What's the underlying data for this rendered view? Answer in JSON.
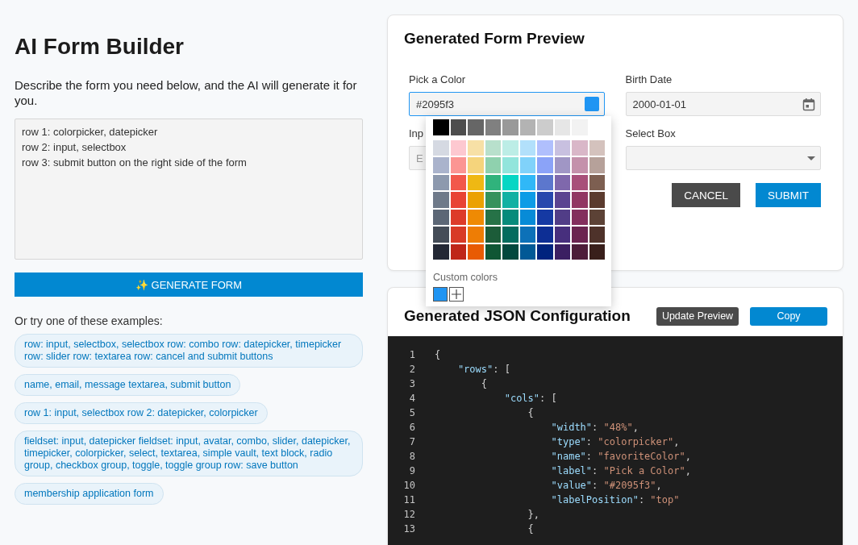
{
  "builder": {
    "title": "AI Form Builder",
    "description": "Describe the form you need below, and the AI will generate it for you.",
    "prompt": "row 1: colorpicker, datepicker\nrow 2: input, selectbox\nrow 3: submit button on the right side of the form",
    "generate_button": "✨ GENERATE FORM",
    "examples_heading": "Or try one of these examples:",
    "examples": [
      "row: input, selectbox, selectbox row: combo row: datepicker, timepicker row: slider row: textarea row: cancel and submit buttons",
      "name, email, message textarea, submit button",
      "row 1: input, selectbox row 2: datepicker, colorpicker",
      "fieldset: input, datepicker fieldset: input, avatar, combo, slider, datepicker, timepicker, colorpicker, select, textarea, simple vault, text block, radio group, checkbox group, toggle, toggle group row: save button",
      "membership application form"
    ]
  },
  "preview": {
    "title": "Generated Form Preview",
    "fields": [
      {
        "kind": "color",
        "label": "Pick a Color",
        "value": "#2095f3",
        "color": "#2095f3"
      },
      {
        "kind": "date",
        "label": "Birth Date",
        "value": "2000-01-01"
      },
      {
        "kind": "input",
        "label": "Inp",
        "placeholder": "E"
      },
      {
        "kind": "select",
        "label": "Select Box"
      }
    ],
    "buttons": [
      {
        "kind": "cancel",
        "label": "CANCEL"
      },
      {
        "kind": "submit",
        "label": "SUBMIT"
      }
    ],
    "color_picker": {
      "grays": [
        {
          "color": "#000000"
        },
        {
          "color": "#4d4d4d"
        },
        {
          "color": "#666666"
        },
        {
          "color": "#808080"
        },
        {
          "color": "#999999"
        },
        {
          "color": "#b3b3b3"
        },
        {
          "color": "#cccccc"
        },
        {
          "color": "#e6e6e6"
        },
        {
          "color": "#f2f2f2"
        }
      ],
      "palette": [
        {
          "swatches": [
            {
              "color": "#d5d9e2"
            },
            {
              "color": "#fdc8d0"
            },
            {
              "color": "#f7e0a6"
            },
            {
              "color": "#b8e0cc"
            },
            {
              "color": "#bcede6"
            },
            {
              "color": "#b2e0fb"
            },
            {
              "color": "#b0bffd"
            },
            {
              "color": "#c8c0e0"
            },
            {
              "color": "#d9b7c8"
            },
            {
              "color": "#d4c2bd"
            }
          ]
        },
        {
          "swatches": [
            {
              "color": "#aab3cc"
            },
            {
              "color": "#fb9593"
            },
            {
              "color": "#f5d47c"
            },
            {
              "color": "#8fd1ae"
            },
            {
              "color": "#92e5dc"
            },
            {
              "color": "#80d2fa"
            },
            {
              "color": "#8ba3f8"
            },
            {
              "color": "#a096c5"
            },
            {
              "color": "#c491ab"
            },
            {
              "color": "#b6a19a"
            }
          ]
        },
        {
          "swatches": [
            {
              "color": "#8d99ae"
            },
            {
              "color": "#f2584b"
            },
            {
              "color": "#efb813"
            },
            {
              "color": "#30b37c"
            },
            {
              "color": "#06d6c4"
            },
            {
              "color": "#30b8f7"
            },
            {
              "color": "#5c77cd"
            },
            {
              "color": "#7f68ac"
            },
            {
              "color": "#a8507a"
            },
            {
              "color": "#7d5f51"
            }
          ]
        },
        {
          "swatches": [
            {
              "color": "#6f7a8a"
            },
            {
              "color": "#e84435"
            },
            {
              "color": "#eba102"
            },
            {
              "color": "#36925d"
            },
            {
              "color": "#12b1a3"
            },
            {
              "color": "#0d9ce6"
            },
            {
              "color": "#2748ad"
            },
            {
              "color": "#5b4491"
            },
            {
              "color": "#913763"
            },
            {
              "color": "#5b3b2e"
            }
          ]
        },
        {
          "swatches": [
            {
              "color": "#5c6776"
            },
            {
              "color": "#dd3b2a"
            },
            {
              "color": "#ef8a03"
            },
            {
              "color": "#267247"
            },
            {
              "color": "#068b7b"
            },
            {
              "color": "#078bd7"
            },
            {
              "color": "#1539a3"
            },
            {
              "color": "#513d87"
            },
            {
              "color": "#832e5d"
            },
            {
              "color": "#5c4236"
            }
          ]
        },
        {
          "swatches": [
            {
              "color": "#444c57"
            },
            {
              "color": "#d83a26"
            },
            {
              "color": "#ee7d05"
            },
            {
              "color": "#1c5c39"
            },
            {
              "color": "#036c5e"
            },
            {
              "color": "#0d71b8"
            },
            {
              "color": "#0d2e94"
            },
            {
              "color": "#472f7d"
            },
            {
              "color": "#6b2450"
            },
            {
              "color": "#4e322a"
            }
          ]
        },
        {
          "swatches": [
            {
              "color": "#232835"
            },
            {
              "color": "#bf2618"
            },
            {
              "color": "#e85b03"
            },
            {
              "color": "#0f5634"
            },
            {
              "color": "#02483d"
            },
            {
              "color": "#015996"
            },
            {
              "color": "#00237e"
            },
            {
              "color": "#3b1f62"
            },
            {
              "color": "#4d1d39"
            },
            {
              "color": "#391f1b"
            }
          ]
        }
      ],
      "custom_label": "Custom colors",
      "custom_colors": [
        {
          "color": "#2095f3"
        }
      ]
    }
  },
  "json_config": {
    "title": "Generated JSON Configuration",
    "buttons": [
      {
        "kind": "secondary",
        "label": "Update Preview"
      },
      {
        "kind": "primary",
        "label": "Copy"
      }
    ],
    "lines": [
      {
        "number": "1",
        "tokens": [
          {
            "kind": "punct",
            "text": "{"
          }
        ]
      },
      {
        "number": "2",
        "tokens": [
          {
            "kind": "key",
            "text": "    \"rows\""
          },
          {
            "kind": "punct",
            "text": ": ["
          }
        ]
      },
      {
        "number": "3",
        "tokens": [
          {
            "kind": "punct",
            "text": "        {"
          }
        ]
      },
      {
        "number": "4",
        "tokens": [
          {
            "kind": "key",
            "text": "            \"cols\""
          },
          {
            "kind": "punct",
            "text": ": ["
          }
        ]
      },
      {
        "number": "5",
        "tokens": [
          {
            "kind": "punct",
            "text": "                {"
          }
        ]
      },
      {
        "number": "6",
        "tokens": [
          {
            "kind": "key",
            "text": "                    \"width\""
          },
          {
            "kind": "punct",
            "text": ": "
          },
          {
            "kind": "string",
            "text": "\"48%\""
          },
          {
            "kind": "punct",
            "text": ","
          }
        ]
      },
      {
        "number": "7",
        "tokens": [
          {
            "kind": "key",
            "text": "                    \"type\""
          },
          {
            "kind": "punct",
            "text": ": "
          },
          {
            "kind": "string",
            "text": "\"colorpicker\""
          },
          {
            "kind": "punct",
            "text": ","
          }
        ]
      },
      {
        "number": "8",
        "tokens": [
          {
            "kind": "key",
            "text": "                    \"name\""
          },
          {
            "kind": "punct",
            "text": ": "
          },
          {
            "kind": "string",
            "text": "\"favoriteColor\""
          },
          {
            "kind": "punct",
            "text": ","
          }
        ]
      },
      {
        "number": "9",
        "tokens": [
          {
            "kind": "key",
            "text": "                    \"label\""
          },
          {
            "kind": "punct",
            "text": ": "
          },
          {
            "kind": "string",
            "text": "\"Pick a Color\""
          },
          {
            "kind": "punct",
            "text": ","
          }
        ]
      },
      {
        "number": "10",
        "tokens": [
          {
            "kind": "key",
            "text": "                    \"value\""
          },
          {
            "kind": "punct",
            "text": ": "
          },
          {
            "kind": "string",
            "text": "\"#2095f3\""
          },
          {
            "kind": "punct",
            "text": ","
          }
        ]
      },
      {
        "number": "11",
        "tokens": [
          {
            "kind": "key",
            "text": "                    \"labelPosition\""
          },
          {
            "kind": "punct",
            "text": ": "
          },
          {
            "kind": "string",
            "text": "\"top\""
          }
        ]
      },
      {
        "number": "12",
        "tokens": [
          {
            "kind": "punct",
            "text": "                },"
          }
        ]
      },
      {
        "number": "13",
        "tokens": [
          {
            "kind": "punct",
            "text": "                {"
          }
        ]
      }
    ]
  }
}
